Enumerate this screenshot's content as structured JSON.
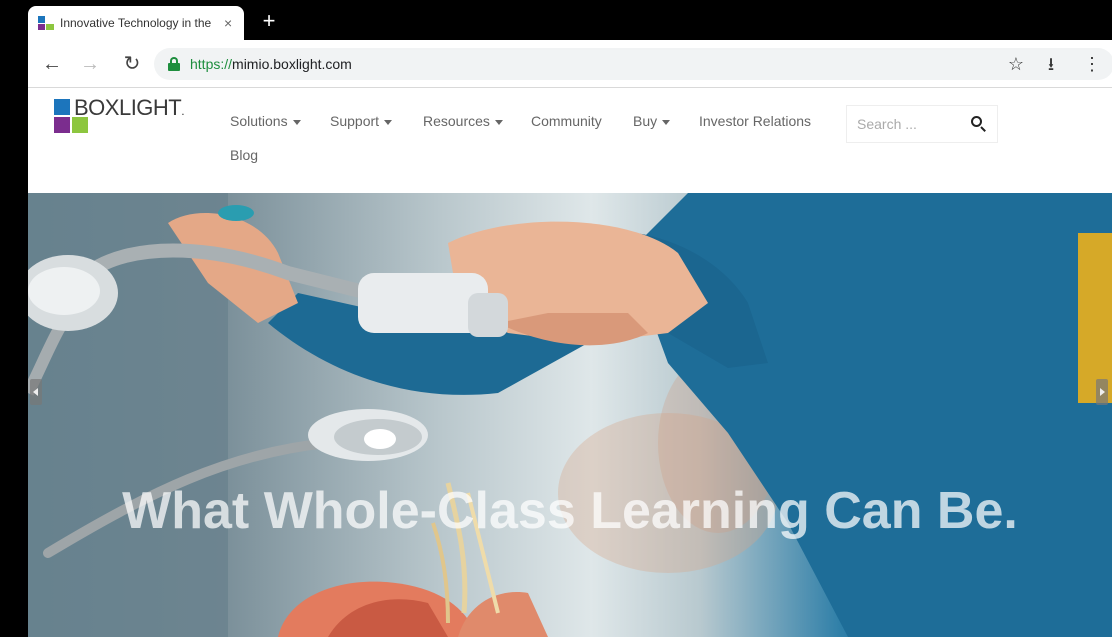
{
  "browser": {
    "tab_title": "Innovative Technology in the",
    "tab_close": "×",
    "new_tab": "+",
    "url_scheme": "https://",
    "url_host": "mimio.boxlight.com",
    "icons": [
      "back-arrow-icon",
      "forward-arrow-icon",
      "reload-icon",
      "lock-icon",
      "star-icon",
      "download-icon",
      "kebab-menu-icon"
    ]
  },
  "site": {
    "logo_text": "BOXLIGHT",
    "logo_mark": ".",
    "nav": {
      "solutions": "Solutions",
      "support": "Support",
      "resources": "Resources",
      "community": "Community",
      "buy": "Buy",
      "investor_relations": "Investor Relations",
      "blog": "Blog"
    },
    "search_placeholder": "Search ..."
  },
  "hero": {
    "headline": "What Whole-Class Learning Can Be."
  },
  "colors": {
    "logo_blue": "#1c75bc",
    "logo_purple": "#7b2d8e",
    "logo_green": "#8dc63f",
    "lock_green": "#1e8e3e",
    "sweater_blue": "#1d6a94"
  }
}
